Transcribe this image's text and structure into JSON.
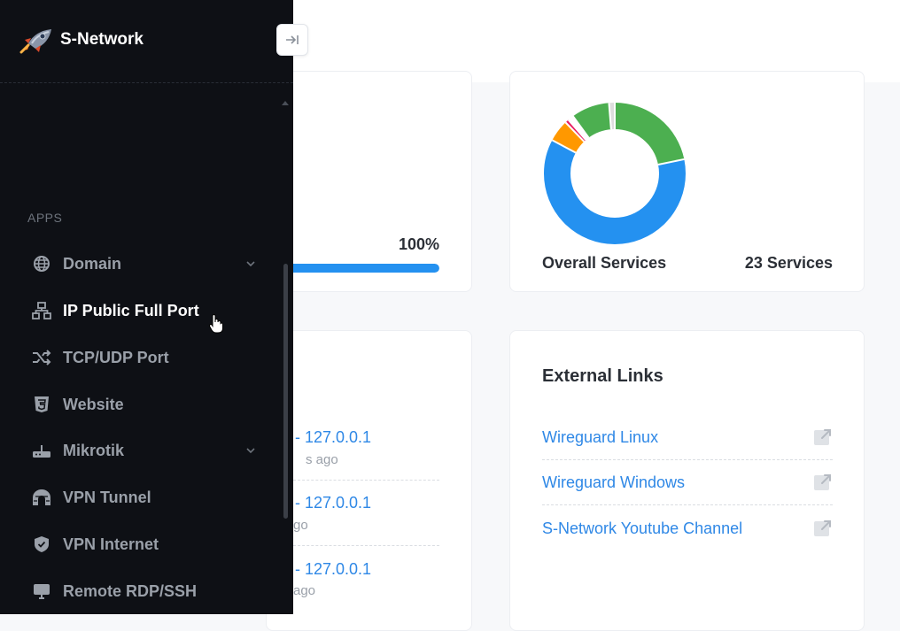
{
  "brand": {
    "name": "S-Network"
  },
  "sidebar": {
    "section_label": "APPS",
    "items": [
      {
        "label": "Domain",
        "icon": "globe-icon",
        "has_submenu": true
      },
      {
        "label": "IP Public Full Port",
        "icon": "network-icon",
        "active": true
      },
      {
        "label": "TCP/UDP Port",
        "icon": "shuffle-icon"
      },
      {
        "label": "Website",
        "icon": "html5-icon"
      },
      {
        "label": "Mikrotik",
        "icon": "router-icon",
        "has_submenu": true
      },
      {
        "label": "VPN Tunnel",
        "icon": "tunnel-icon"
      },
      {
        "label": "VPN Internet",
        "icon": "shield-icon"
      },
      {
        "label": "Remote RDP/SSH",
        "icon": "monitor-icon"
      }
    ]
  },
  "progress": {
    "value_label": "100%",
    "percent": 100,
    "color": "#2491f0"
  },
  "services_chart": {
    "label": "Overall Services",
    "count_label": "23 Services",
    "chart_data": {
      "type": "pie",
      "slices": [
        {
          "value": 5.0,
          "color": "#4caf50"
        },
        {
          "value": 14.0,
          "color": "#2491f0"
        },
        {
          "value": 1.15,
          "color": "#ff9800"
        },
        {
          "value": 0.2,
          "color": "#e91e63"
        },
        {
          "value": 0.3,
          "color": "#ffffff"
        },
        {
          "value": 2.0,
          "color": "#4caf50"
        },
        {
          "value": 0.3,
          "color": "#dddddd"
        }
      ]
    }
  },
  "activity": {
    "items": [
      {
        "ip": "- 127.0.0.1",
        "ago": "s ago"
      },
      {
        "ip": "- 127.0.0.1",
        "ago": "go"
      },
      {
        "ip": "- 127.0.0.1",
        "ago": "ago"
      }
    ]
  },
  "external_links": {
    "title": "External Links",
    "items": [
      {
        "label": "Wireguard Linux"
      },
      {
        "label": "Wireguard Windows"
      },
      {
        "label": "S-Network Youtube Channel"
      }
    ]
  },
  "colors": {
    "sidebar_bg": "#0e1015",
    "link": "#2f88e6",
    "accent": "#2491f0"
  }
}
